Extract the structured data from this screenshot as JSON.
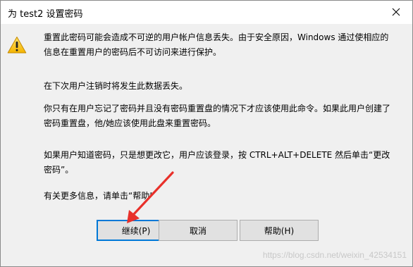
{
  "window": {
    "title": "为 test2 设置密码"
  },
  "icons": {
    "warning": "warning-icon",
    "close": "close-icon"
  },
  "messages": {
    "p1_line1": "重置此密码可能会造成不可逆的用户帐户信息丢失。由于安全原因，Windows 通过使相应的",
    "p1_line2": "信息在重置用户的密码后不可访问来进行保护。",
    "p2": "在下次用户注销时将发生此数据丢失。",
    "p3_line1": "你只有在用户忘记了密码并且没有密码重置盘的情况下才应该使用此命令。如果此用户创建了",
    "p3_line2": "密码重置盘，他/她应该使用此盘来重置密码。",
    "p4_line1": "如果用户知道密码，只是想更改它，用户应该登录，按 CTRL+ALT+DELETE 然后单击“更改",
    "p4_line2": "密码”。",
    "p5": "有关更多信息，请单击“帮助”"
  },
  "buttons": {
    "continue": "继续(P)",
    "cancel": "取消",
    "help": "帮助(H)"
  },
  "annotation": {
    "arrow_color": "#e8302a"
  },
  "watermark": "https://blog.csdn.net/weixin_42534151"
}
